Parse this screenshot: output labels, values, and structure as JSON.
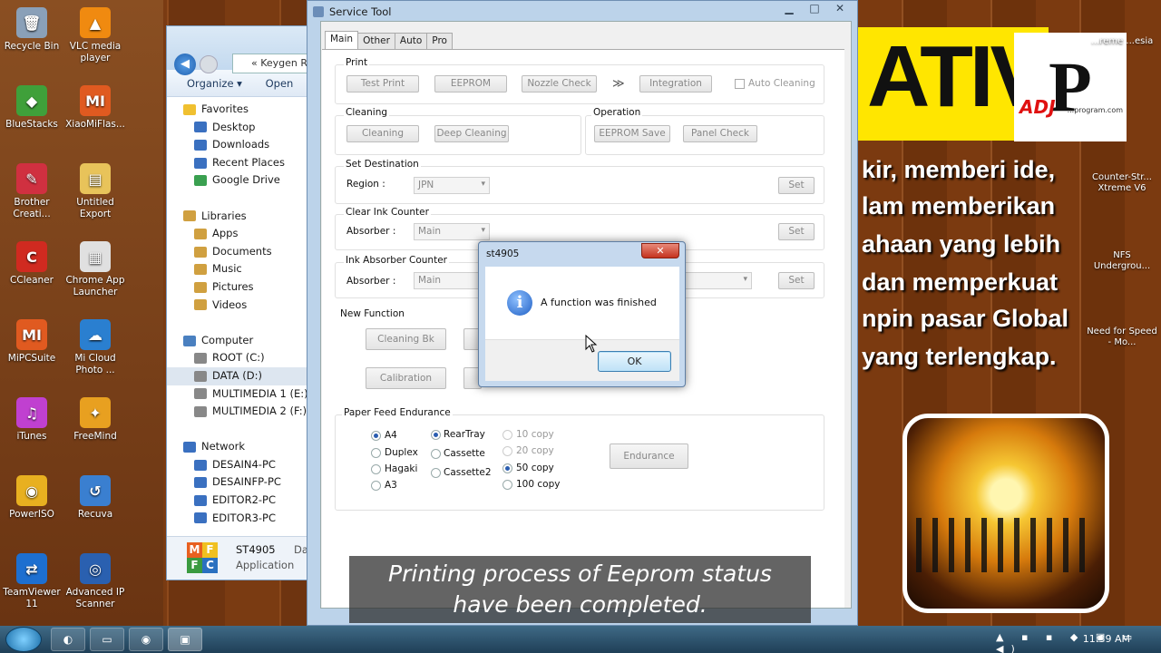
{
  "desktop_left": [
    {
      "label": "Recycle Bin",
      "color": "#8aa0b8",
      "glyph": "🗑"
    },
    {
      "label": "VLC media player",
      "color": "#f08a10",
      "glyph": "▲"
    },
    {
      "label": "BlueStacks",
      "color": "#3fa03a",
      "glyph": "◆"
    },
    {
      "label": "XiaoMiFlas...",
      "color": "#e05a20",
      "glyph": "MI"
    },
    {
      "label": "Brother Creati...",
      "color": "#d03040",
      "glyph": "✎"
    },
    {
      "label": "Untitled Export",
      "color": "#e8c35a",
      "glyph": "▤"
    },
    {
      "label": "CCleaner",
      "color": "#d02a20",
      "glyph": "C"
    },
    {
      "label": "Chrome App Launcher",
      "color": "#e0e0e0",
      "glyph": "▦"
    },
    {
      "label": "MiPCSuite",
      "color": "#e05a20",
      "glyph": "MI"
    },
    {
      "label": "Mi Cloud Photo ...",
      "color": "#2a7fd0",
      "glyph": "☁"
    },
    {
      "label": "iTunes",
      "color": "#c040d0",
      "glyph": "♫"
    },
    {
      "label": "FreeMind",
      "color": "#e8a020",
      "glyph": "✦"
    },
    {
      "label": "PowerISO",
      "color": "#e8b020",
      "glyph": "◉"
    },
    {
      "label": "Recuva",
      "color": "#3a7fd0",
      "glyph": "↺"
    },
    {
      "label": "TeamViewer 11",
      "color": "#1d6fd0",
      "glyph": "⇄"
    },
    {
      "label": "Advanced IP Scanner",
      "color": "#2a60b0",
      "glyph": "◎"
    }
  ],
  "desktop_right": [
    {
      "label": "...reme ...esia"
    },
    {
      "label": "Counter-Str... Xtreme V6"
    },
    {
      "label": "NFS Undergrou..."
    },
    {
      "label": "Need for Speed - Mo..."
    }
  ],
  "poster": {
    "banner": "ATIV",
    "logo_letter": "P",
    "logo_adj": "ADJ",
    "logo_url": "...program.com",
    "lines": [
      "kir, memberi ide,",
      "lam memberikan",
      "ahaan yang lebih",
      "dan memperkuat",
      "npin pasar Global",
      "yang terlengkap."
    ]
  },
  "explorer": {
    "path": "«  Keygen R",
    "organize": "Organize ▾",
    "open": "Open",
    "tree": [
      {
        "label": "Favorites",
        "indent": 18,
        "color": "#f0c030"
      },
      {
        "label": "Desktop",
        "indent": 30,
        "color": "#3a70c0"
      },
      {
        "label": "Downloads",
        "indent": 30,
        "color": "#3a70c0"
      },
      {
        "label": "Recent Places",
        "indent": 30,
        "color": "#3a70c0"
      },
      {
        "label": "Google Drive",
        "indent": 30,
        "color": "#3aa050"
      },
      {
        "label": "",
        "indent": 0,
        "color": "transparent"
      },
      {
        "label": "Libraries",
        "indent": 18,
        "color": "#d0a040"
      },
      {
        "label": "Apps",
        "indent": 30,
        "color": "#d0a040"
      },
      {
        "label": "Documents",
        "indent": 30,
        "color": "#d0a040"
      },
      {
        "label": "Music",
        "indent": 30,
        "color": "#d0a040"
      },
      {
        "label": "Pictures",
        "indent": 30,
        "color": "#d0a040"
      },
      {
        "label": "Videos",
        "indent": 30,
        "color": "#d0a040"
      },
      {
        "label": "",
        "indent": 0,
        "color": "transparent"
      },
      {
        "label": "Computer",
        "indent": 18,
        "color": "#4a80c0"
      },
      {
        "label": "ROOT (C:)",
        "indent": 30,
        "color": "#888"
      },
      {
        "label": "DATA (D:)",
        "indent": 30,
        "color": "#888",
        "sel": true
      },
      {
        "label": "MULTIMEDIA 1 (E:)",
        "indent": 30,
        "color": "#888"
      },
      {
        "label": "MULTIMEDIA 2 (F:)",
        "indent": 30,
        "color": "#888"
      },
      {
        "label": "",
        "indent": 0,
        "color": "transparent"
      },
      {
        "label": "Network",
        "indent": 18,
        "color": "#3a70c0"
      },
      {
        "label": "DESAIN4-PC",
        "indent": 30,
        "color": "#3a70c0"
      },
      {
        "label": "DESAINFP-PC",
        "indent": 30,
        "color": "#3a70c0"
      },
      {
        "label": "EDITOR2-PC",
        "indent": 30,
        "color": "#3a70c0"
      },
      {
        "label": "EDITOR3-PC",
        "indent": 30,
        "color": "#3a70c0"
      }
    ],
    "status_name": "ST4905",
    "status_type": "Application",
    "status_extra": "Da"
  },
  "service_tool": {
    "title": "Service Tool",
    "tabs": [
      "Main",
      "Other",
      "Auto",
      "Pro"
    ],
    "print": {
      "label": "Print",
      "test_print": "Test Print",
      "eeprom": "EEPROM",
      "nozzle_check": "Nozzle Check",
      "arrows": "≫",
      "integration": "Integration",
      "auto_cleaning": "Auto Cleaning"
    },
    "cleaning": {
      "label": "Cleaning",
      "cleaning": "Cleaning",
      "deep_cleaning": "Deep Cleaning"
    },
    "operation": {
      "label": "Operation",
      "eeprom_save": "EEPROM Save",
      "panel_check": "Panel Check"
    },
    "set_destination": {
      "label": "Set Destination",
      "region_label": "Region :",
      "region_value": "JPN",
      "set": "Set"
    },
    "clear_ink_counter": {
      "label": "Clear Ink Counter",
      "absorber_label": "Absorber :",
      "absorber_value": "Main",
      "set": "Set"
    },
    "ink_absorber_counter": {
      "label": "Ink Absorber Counter",
      "absorber_label": "Absorber :",
      "absorber_value": "Main",
      "set": "Set"
    },
    "new_function": {
      "label": "New Function",
      "cleaning_bk": "Cleaning Bk",
      "calibration": "Calibration"
    },
    "paper_feed": {
      "label": "Paper Feed Endurance",
      "sizes": [
        "A4",
        "Duplex",
        "Hagaki",
        "A3"
      ],
      "sources": [
        "RearTray",
        "Cassette",
        "Cassette2"
      ],
      "copies": [
        "10 copy",
        "20 copy",
        "50 copy",
        "100 copy"
      ],
      "endurance": "Endurance"
    }
  },
  "dialog": {
    "title": "st4905",
    "close": "✕",
    "message": "A function was finished",
    "ok": "OK"
  },
  "caption": {
    "line1": "Printing process of Eeprom status",
    "line2": "have been completed."
  },
  "taskbar": {
    "clock": "11:39 AM"
  }
}
